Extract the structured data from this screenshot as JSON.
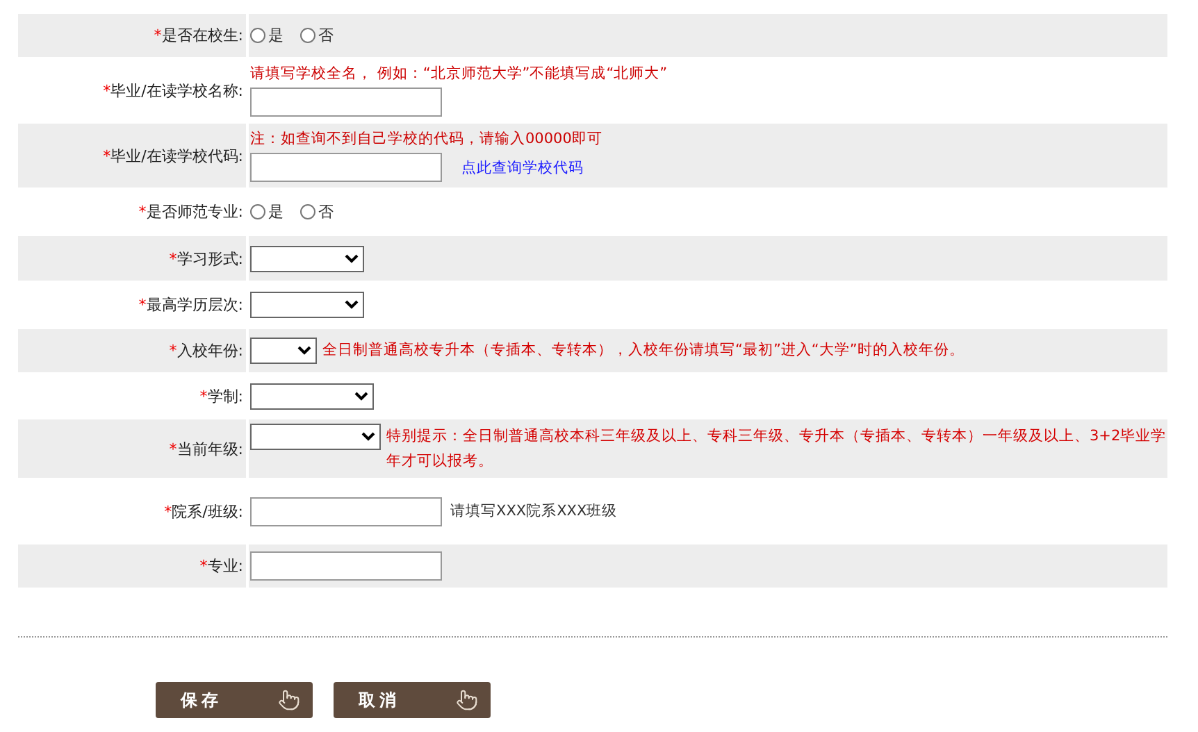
{
  "fields": [
    {
      "asterisk": "*",
      "label": "是否在校生:",
      "kind": "radio",
      "options": [
        {
          "label": "是",
          "selected": false
        },
        {
          "label": "否",
          "selected": false
        }
      ]
    },
    {
      "asterisk": "*",
      "label": "毕业/在读学校名称:",
      "kind": "text",
      "hint_above": "请填写学校全名， 例如：“北京师范大学”不能填写成“北师大”"
    },
    {
      "asterisk": "*",
      "label": "毕业/在读学校代码:",
      "kind": "text",
      "hint_above": "注：如查询不到自己学校的代码，请输入00000即可",
      "link": "点此查询学校代码"
    },
    {
      "asterisk": "*",
      "label": "是否师范专业:",
      "kind": "radio",
      "options": [
        {
          "label": "是",
          "selected": false
        },
        {
          "label": "否",
          "selected": false
        }
      ]
    },
    {
      "asterisk": "*",
      "label": "学习形式:",
      "kind": "select"
    },
    {
      "asterisk": "*",
      "label": "最高学历层次:",
      "kind": "select"
    },
    {
      "asterisk": "*",
      "label": "入校年份:",
      "kind": "select",
      "hint_after": "全日制普通高校专升本（专插本、专转本），入校年份请填写“最初”进入“大学”时的入校年份。"
    },
    {
      "asterisk": "*",
      "label": "学制:",
      "kind": "select"
    },
    {
      "asterisk": "*",
      "label": "当前年级:",
      "kind": "select",
      "hint_after": "特别提示：全日制普通高校本科三年级及以上、专科三年级、专升本（专插本、专转本）一年级及以上、3+2毕业学年才可以报考。"
    },
    {
      "asterisk": "*",
      "label": "院系/班级:",
      "kind": "text",
      "note_after": "请填写XXX院系XXX班级"
    },
    {
      "asterisk": "*",
      "label": "专业:",
      "kind": "text"
    }
  ],
  "buttons": [
    {
      "label": "保存"
    },
    {
      "label": "取消"
    }
  ]
}
